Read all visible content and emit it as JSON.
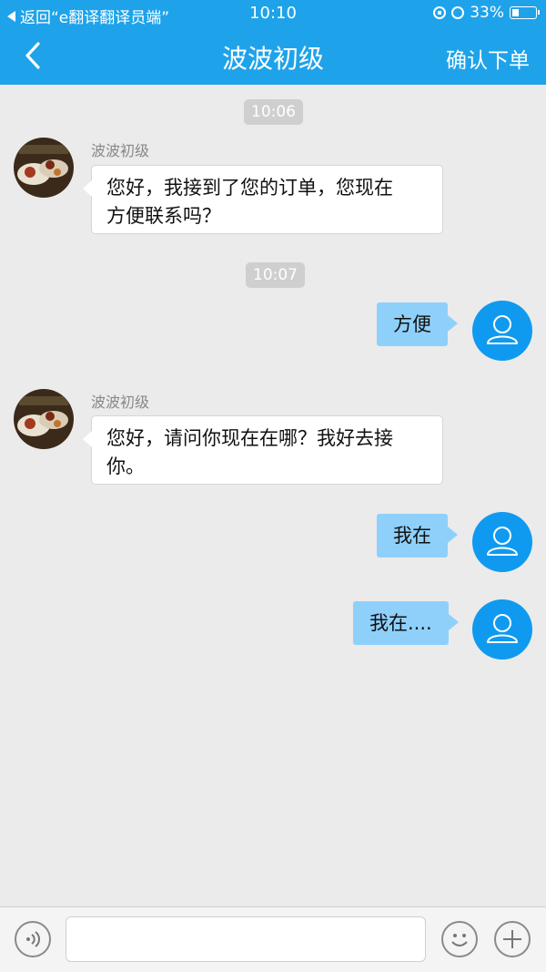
{
  "status_bar": {
    "back_to_app": "返回“e翻译翻译员端”",
    "time": "10:10",
    "battery": "33%",
    "battery_level": 0.33
  },
  "nav": {
    "title": "波波初级",
    "confirm_label": "确认下单"
  },
  "messages": [
    {
      "kind": "time",
      "text": "10:06"
    },
    {
      "kind": "incoming",
      "sender": "波波初级",
      "line1": "您好，我接到了您的订单，您现在",
      "line2": "方便联系吗？"
    },
    {
      "kind": "time",
      "text": "10:07"
    },
    {
      "kind": "outgoing",
      "text": "方便"
    },
    {
      "kind": "incoming",
      "sender": "波波初级",
      "line1": "您好，请问你现在在哪？我好去接",
      "line2": "你。"
    },
    {
      "kind": "outgoing",
      "text": "我在"
    },
    {
      "kind": "outgoing",
      "text": "我在...."
    }
  ],
  "colors": {
    "header": "#1ea3ea",
    "outgoing_bubble": "#8fd0fb",
    "user_avatar": "#0f9af0",
    "background": "#ebebeb"
  },
  "input_bar": {
    "voice_icon": "voice-icon",
    "emoji_icon": "emoji-icon",
    "plus_icon": "plus-icon",
    "message_value": ""
  }
}
